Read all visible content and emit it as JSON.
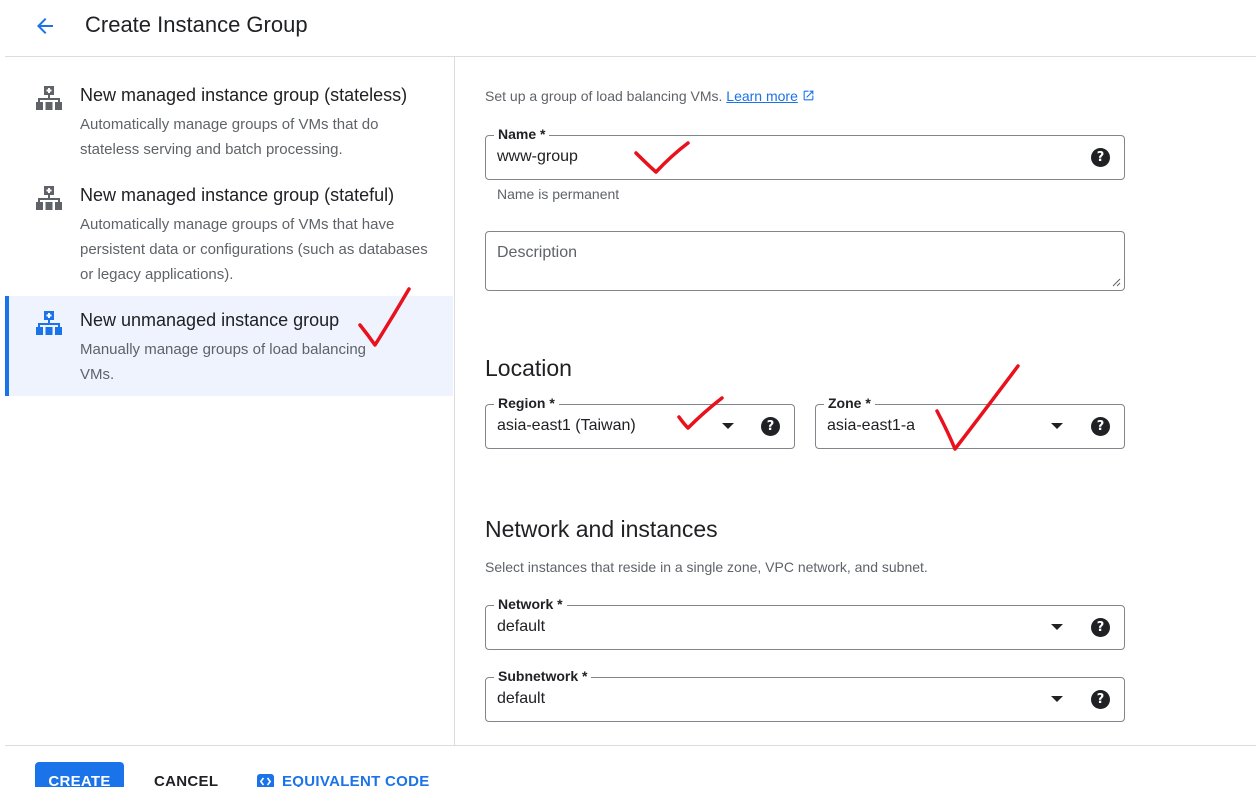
{
  "header": {
    "back_icon": "arrow-back-icon",
    "title": "Create Instance Group"
  },
  "options": [
    {
      "icon": "instance-group-icon",
      "title": "New managed instance group (stateless)",
      "desc": "Automatically manage groups of VMs that do stateless serving and batch processing.",
      "selected": false
    },
    {
      "icon": "instance-group-icon",
      "title": "New managed instance group (stateful)",
      "desc": "Automatically manage groups of VMs that have persistent data or configurations (such as databases or legacy applications).",
      "selected": false
    },
    {
      "icon": "instance-group-icon",
      "title": "New unmanaged instance group",
      "desc": "Manually manage groups of load balancing VMs.",
      "selected": true
    }
  ],
  "intro": {
    "text": "Set up a group of load balancing VMs.",
    "link": "Learn more",
    "link_icon": "open-in-new-icon"
  },
  "name_field": {
    "label": "Name *",
    "value": "www-group",
    "hint": "Name is permanent"
  },
  "description_field": {
    "placeholder": "Description"
  },
  "location": {
    "title": "Location",
    "region": {
      "label": "Region *",
      "value": "asia-east1 (Taiwan)"
    },
    "zone": {
      "label": "Zone *",
      "value": "asia-east1-a"
    }
  },
  "network_section": {
    "title": "Network and instances",
    "desc": "Select instances that reside in a single zone, VPC network, and subnet.",
    "network": {
      "label": "Network *",
      "value": "default"
    },
    "subnetwork": {
      "label": "Subnetwork *",
      "value": "default"
    }
  },
  "help_glyph": "?",
  "footer": {
    "create": "CREATE",
    "cancel": "CANCEL",
    "equivalent_code": "EQUIVALENT CODE"
  },
  "colors": {
    "accent": "#1a73e8",
    "selected_bg": "#eef3fd",
    "annotation_red": "#e8111c"
  }
}
